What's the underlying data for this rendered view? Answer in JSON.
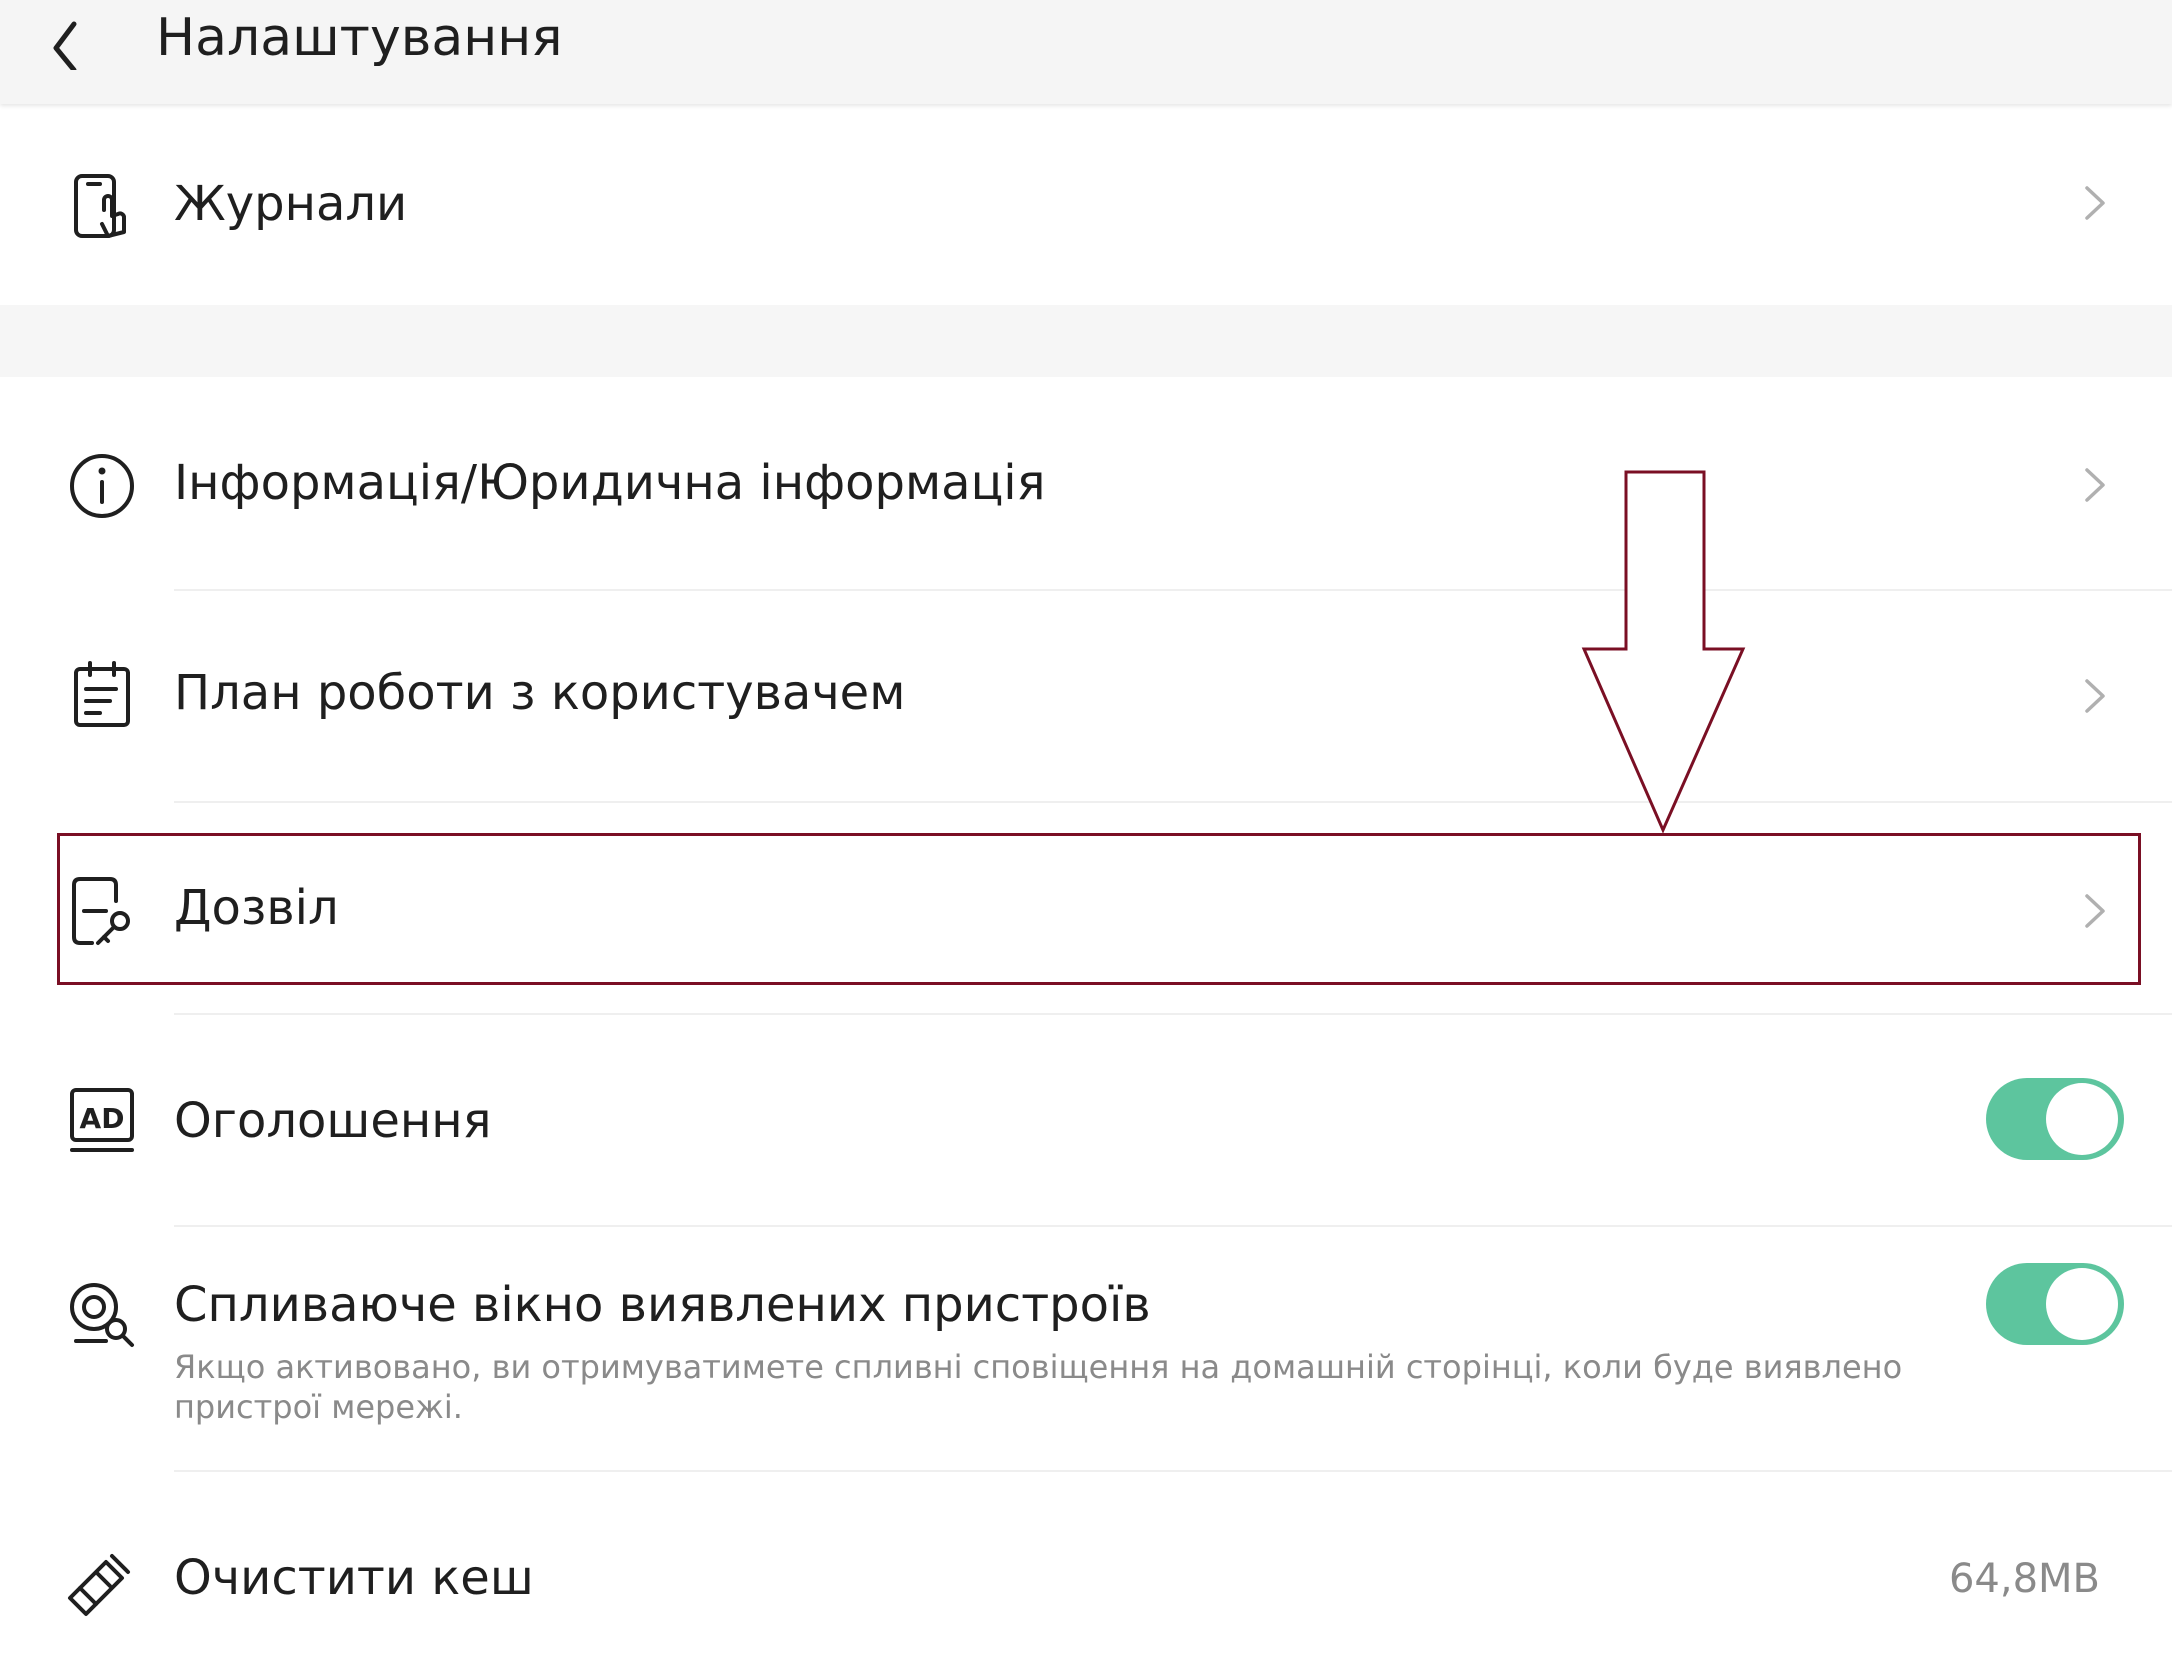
{
  "header": {
    "title": "Налаштування"
  },
  "rows": {
    "journals": {
      "label": "Журнали"
    },
    "info": {
      "label": "Інформація/Юридична інформація"
    },
    "plan": {
      "label": "План роботи з користувачем"
    },
    "permission": {
      "label": "Дозвіл"
    },
    "ads": {
      "label": "Оголошення",
      "toggle_on": true
    },
    "popup": {
      "label": "Спливаюче вікно виявлених пристроїв",
      "description": "Якщо активовано, ви отримуватимете спливні сповіщення на домашній сторінці, коли буде виявлено пристрої мережі.",
      "toggle_on": true
    },
    "cache": {
      "label": "Очистити кеш",
      "value": "64,8MB"
    }
  },
  "icons": {
    "back": "chevron-left-icon",
    "journals": "phone-touch-icon",
    "info": "info-circle-icon",
    "plan": "calendar-list-icon",
    "permission": "document-key-icon",
    "ads": "ad-icon",
    "popup": "device-search-icon",
    "cache": "broom-icon",
    "chevron": "chevron-right-icon"
  },
  "colors": {
    "toggle_on": "#5dc59e",
    "annotation": "#7a0f24",
    "secondary_text": "#8a8a8a"
  }
}
